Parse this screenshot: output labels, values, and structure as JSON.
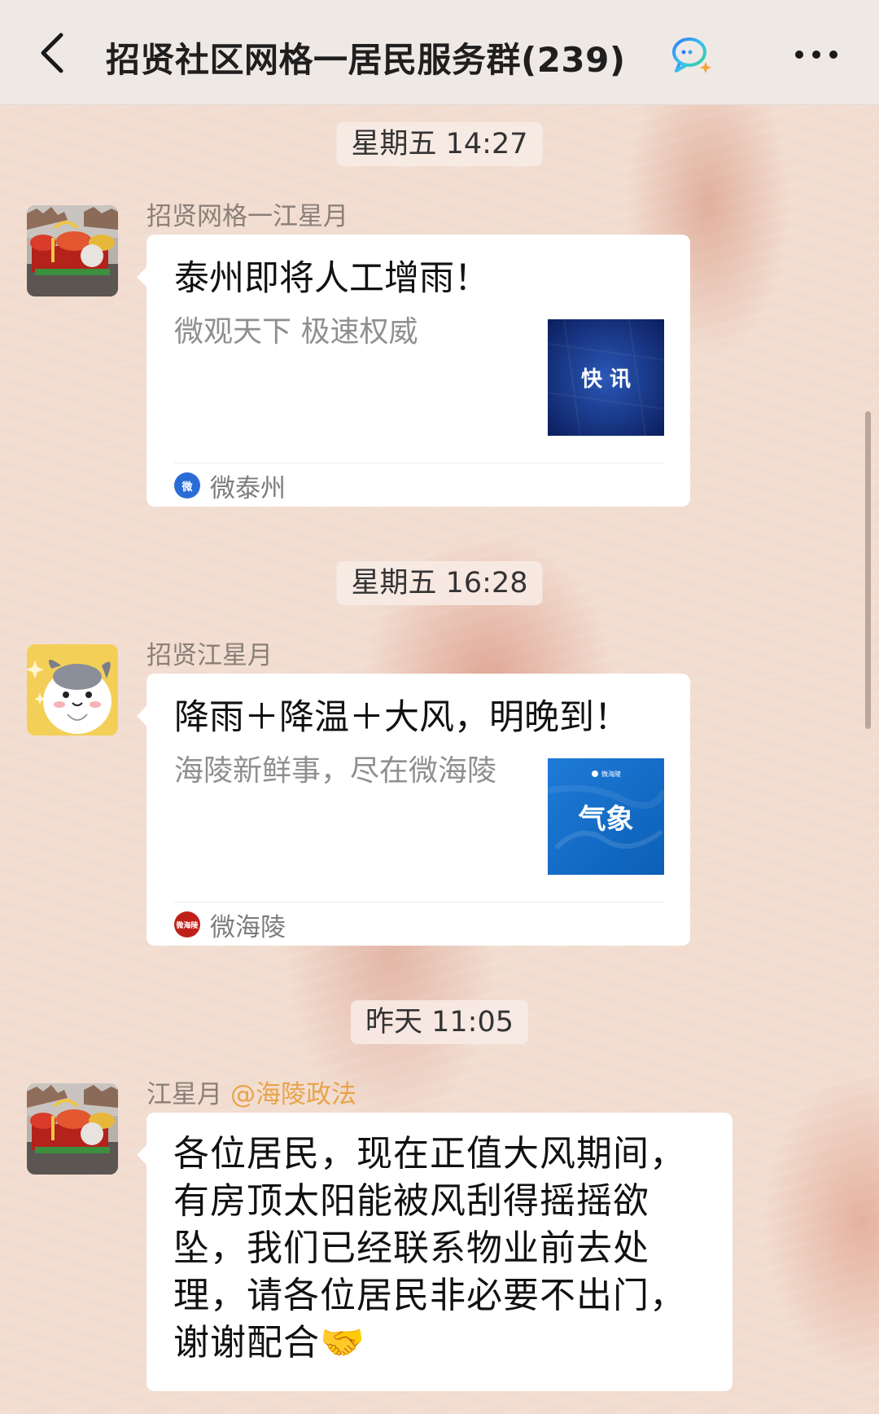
{
  "header": {
    "title": "招贤社区网格一居民服务群(239)"
  },
  "messages": [
    {
      "timestamp": "星期五 14:27",
      "sender": "招贤网格一江星月",
      "card": {
        "title": "泰州即将人工增雨！",
        "desc": "微观天下 极速权威",
        "thumb_text": "快 讯",
        "source": "微泰州",
        "source_logo_text": "微"
      }
    },
    {
      "timestamp": "星期五 16:28",
      "sender": "招贤江星月",
      "card": {
        "title": "降雨＋降温＋大风，明晚到！",
        "desc": "海陵新鲜事，尽在微海陵",
        "thumb_text": "气象",
        "thumb_top_text": "微海陵",
        "source": "微海陵",
        "source_logo_text": "微海陵"
      }
    },
    {
      "timestamp": "昨天 11:05",
      "sender": "江星月",
      "mention": "@海陵政法",
      "text": "各位居民，现在正值大风期间，有房顶太阳能被风刮得摇摇欲坠，我们已经联系物业前去处理，请各位居民非必要不出门，谢谢配合🤝"
    }
  ]
}
